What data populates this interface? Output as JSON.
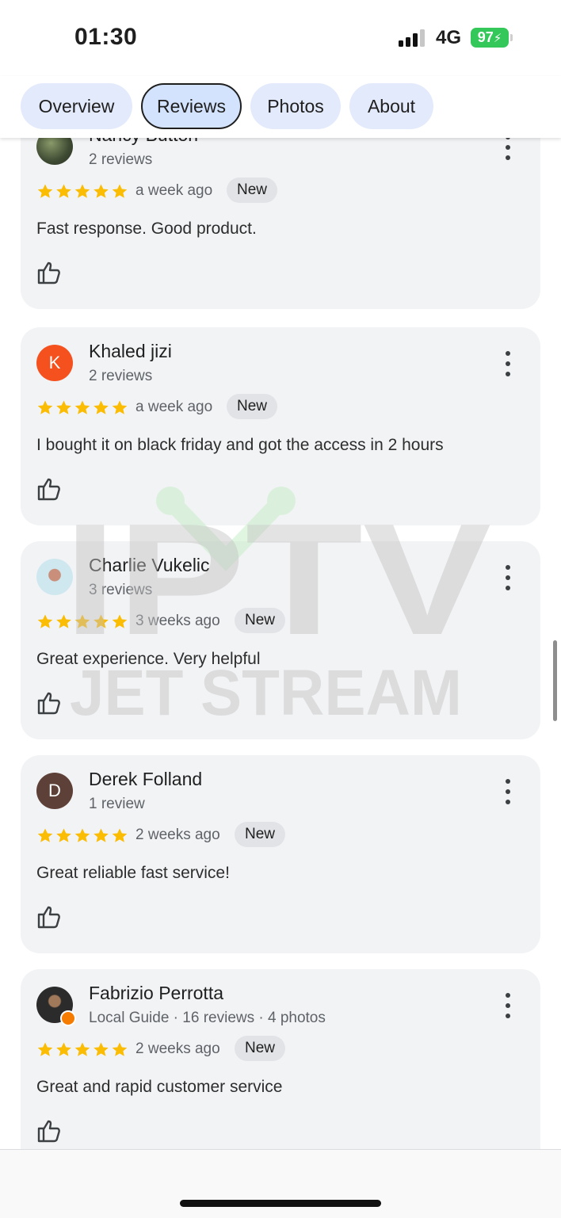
{
  "status_bar": {
    "time": "01:30",
    "network": "4G",
    "battery": "97"
  },
  "tabs": [
    {
      "label": "Overview",
      "active": false
    },
    {
      "label": "Reviews",
      "active": true
    },
    {
      "label": "Photos",
      "active": false
    },
    {
      "label": "About",
      "active": false
    }
  ],
  "reviews": [
    {
      "name": "Nancy Button",
      "meta": "2 reviews",
      "rating": 5,
      "age": "a week ago",
      "badge": "New",
      "text": "Fast response. Good product.",
      "avatar": "photo-green"
    },
    {
      "name": "Khaled jizi",
      "meta": "2 reviews",
      "rating": 5,
      "age": "a week ago",
      "badge": "New",
      "text": "I bought it on black friday and got the access in 2 hours",
      "avatar": "K",
      "avatar_color": "#f4511e"
    },
    {
      "name": "Charlie Vukelic",
      "meta": "3 reviews",
      "rating": 5,
      "age": "3 weeks ago",
      "badge": "New",
      "text": "Great experience. Very helpful",
      "avatar": "photo-light"
    },
    {
      "name": "Derek Folland",
      "meta": "1 review",
      "rating": 5,
      "age": "2 weeks ago",
      "badge": "New",
      "text": "Great reliable fast service!",
      "avatar": "D",
      "avatar_color": "#5d4037"
    },
    {
      "name": "Fabrizio Perrotta",
      "meta": "Local Guide · 16 reviews · 4 photos",
      "rating": 5,
      "age": "2 weeks ago",
      "badge": "New",
      "text": "Great and rapid customer service",
      "avatar": "photo-dark"
    }
  ],
  "watermark": {
    "line1": "IPTV",
    "line2": "JET STREAM"
  },
  "colors": {
    "star": "#fbbc04",
    "tab_bg": "#e3eafc",
    "tab_active_bg": "#d3e3fd",
    "card_bg": "#f2f3f5",
    "battery": "#34c759"
  }
}
